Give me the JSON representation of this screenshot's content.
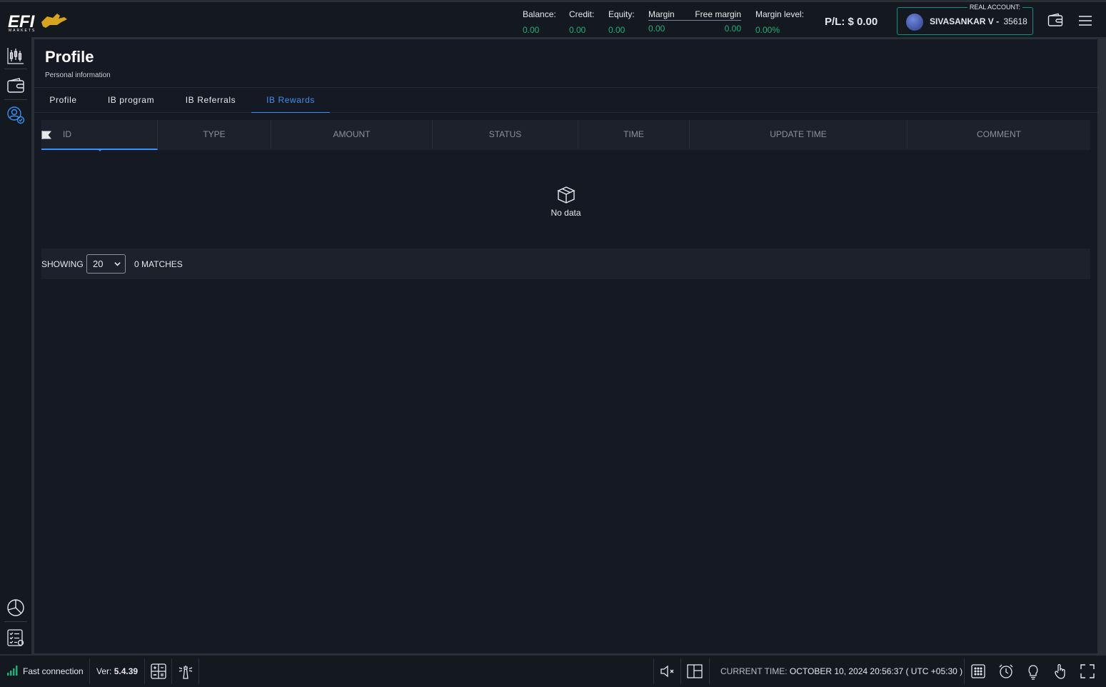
{
  "brand": {
    "logo_text": "EFI",
    "logo_sub": "MARKETS"
  },
  "header": {
    "metrics": [
      {
        "label": "Balance:",
        "value": "0.00"
      },
      {
        "label": "Credit:",
        "value": "0.00"
      },
      {
        "label": "Equity:",
        "value": "0.00"
      },
      {
        "label": "Margin",
        "value": "0.00"
      },
      {
        "label": "Free margin",
        "value": "0.00"
      },
      {
        "label": "Margin level:",
        "value": "0.00%"
      }
    ],
    "pl_label": "P/L:",
    "pl_value": "$ 0.00",
    "account": {
      "type": "REAL ACCOUNT:",
      "name": "SIVASANKAR V -",
      "number": "35618"
    }
  },
  "page": {
    "title": "Profile",
    "subtitle": "Personal information"
  },
  "tabs": [
    {
      "label": "Profile",
      "active": false
    },
    {
      "label": "IB program",
      "active": false
    },
    {
      "label": "IB Referrals",
      "active": false
    },
    {
      "label": "IB Rewards",
      "active": true
    }
  ],
  "table": {
    "columns": [
      "ID",
      "TYPE",
      "AMOUNT",
      "STATUS",
      "TIME",
      "UPDATE TIME",
      "COMMENT"
    ],
    "rows": [],
    "empty_text": "No data"
  },
  "pager": {
    "showing_label": "SHOWING",
    "page_size": "20",
    "matches": "0 MATCHES"
  },
  "footer": {
    "connection": "Fast connection",
    "version_label": "Ver:",
    "version": "5.4.39",
    "time_label": "CURRENT TIME:",
    "time_value": "OCTOBER 10, 2024 20:56:37 ( UTC +05:30 )"
  },
  "colors": {
    "accent": "#3d8ff0",
    "positive": "#1fae7a",
    "account_border": "#1a8a86",
    "panel": "#141923",
    "chrome": "#14181f"
  },
  "icons": [
    "chart-icon",
    "wallet-icon",
    "profile-users-icon",
    "pie-chart-icon",
    "checklist-icon",
    "menu-icon",
    "calculator-icon",
    "lighthouse-icon",
    "mute-icon",
    "layout-icon",
    "calendar-grid-icon",
    "alarm-icon",
    "lightbulb-icon",
    "hand-pointer-icon",
    "fullscreen-icon"
  ]
}
